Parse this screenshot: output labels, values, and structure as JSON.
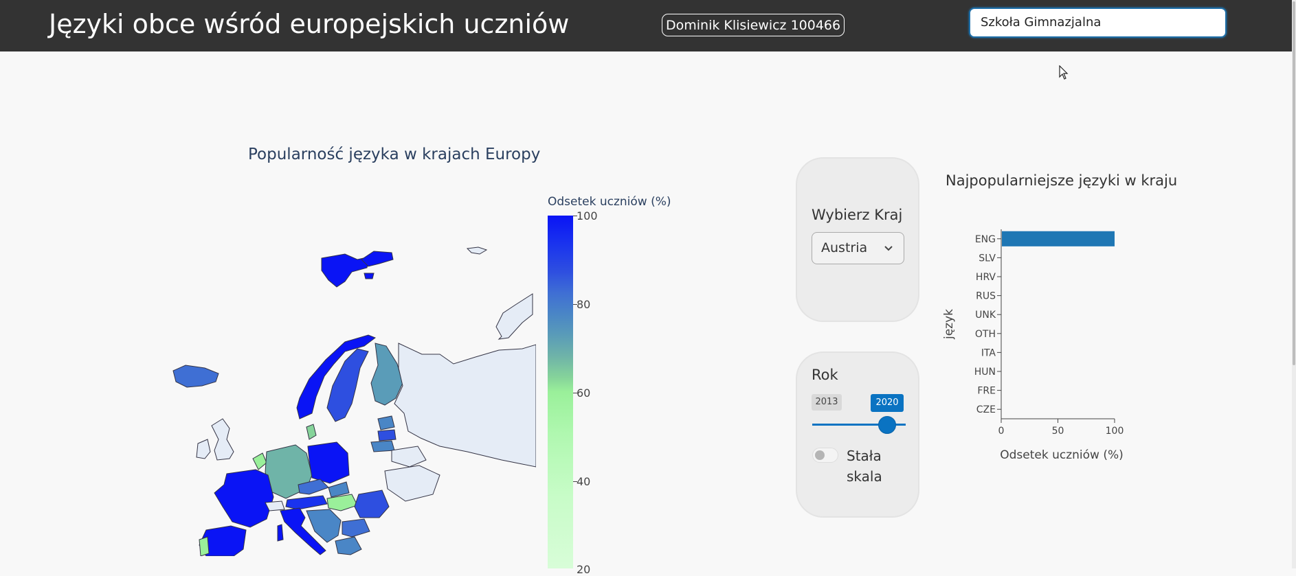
{
  "header": {
    "title": "Języki obce wśród europejskich uczniów",
    "author": "Dominik Klisiewicz 100466",
    "school_select": "Szkoła Gimnazjalna"
  },
  "map": {
    "title": "Popularność języka w krajach Europy",
    "colorbar_title": "Odsetek uczniów (%)",
    "colorbar_ticks": [
      "100",
      "80",
      "60",
      "40",
      "20"
    ]
  },
  "controls": {
    "country_label": "Wybierz Kraj",
    "country_value": "Austria",
    "year_label": "Rok",
    "year_min": "2013",
    "year_max": "2020",
    "fixed_scale_label": "Stała skala",
    "fixed_scale_on": false
  },
  "chart_data": {
    "type": "bar",
    "orientation": "horizontal",
    "title": "Najpopularniejsze języki w kraju",
    "xlabel": "Odsetek uczniów (%)",
    "ylabel": "język",
    "categories": [
      "ENG",
      "SLV",
      "HRV",
      "RUS",
      "UNK",
      "OTH",
      "ITA",
      "HUN",
      "FRE",
      "CZE"
    ],
    "values": [
      100,
      0,
      0,
      0,
      0,
      0,
      0,
      0,
      0,
      0
    ],
    "xlim": [
      0,
      100
    ],
    "xticks": [
      "0",
      "50",
      "100"
    ],
    "bar_color": "#1f77b4",
    "grid": false
  }
}
